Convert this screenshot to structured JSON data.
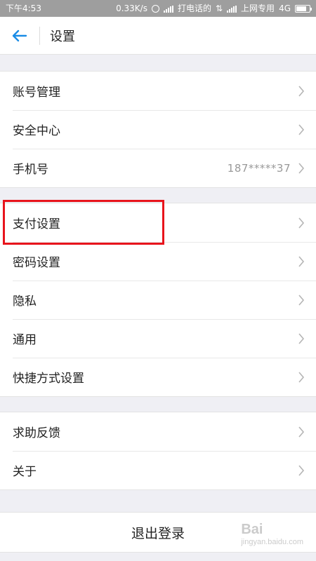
{
  "status_bar": {
    "time": "下午4:53",
    "speed": "0.33K/s",
    "call_label": "打电话的",
    "carrier": "上网专用",
    "network": "4G"
  },
  "header": {
    "title": "设置",
    "back_icon": "arrow-left-icon"
  },
  "sections": [
    {
      "items": [
        {
          "label": "账号管理",
          "value": ""
        },
        {
          "label": "安全中心",
          "value": ""
        },
        {
          "label": "手机号",
          "value": "187*****37"
        }
      ]
    },
    {
      "items": [
        {
          "label": "支付设置",
          "value": ""
        },
        {
          "label": "密码设置",
          "value": ""
        },
        {
          "label": "隐私",
          "value": ""
        },
        {
          "label": "通用",
          "value": ""
        },
        {
          "label": "快捷方式设置",
          "value": ""
        }
      ]
    },
    {
      "items": [
        {
          "label": "求助反馈",
          "value": ""
        },
        {
          "label": "关于",
          "value": ""
        }
      ]
    }
  ],
  "logout": {
    "label": "退出登录"
  },
  "watermark": {
    "text": "Bai",
    "sub": "jingyan.baidu.com"
  },
  "colors": {
    "accent": "#1a8ce6",
    "highlight": "#e8141c",
    "status_bar": "#9e9e9e",
    "background": "#efeff4"
  }
}
